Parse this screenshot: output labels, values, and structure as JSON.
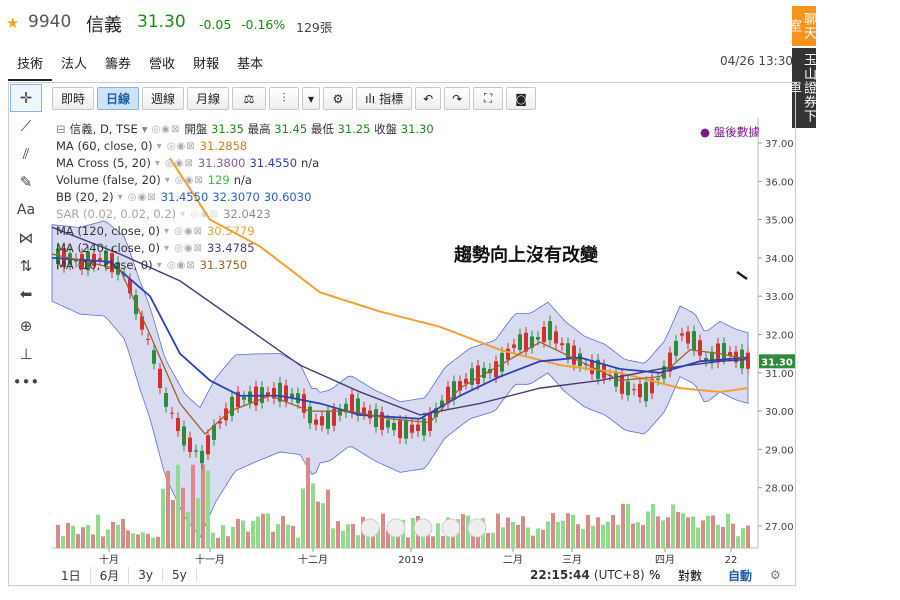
{
  "stock": {
    "code": "9940",
    "name": "信義",
    "price": "31.30",
    "change": "-0.05",
    "change_pct": "-0.16%",
    "volume": "129張"
  },
  "side_tabs": {
    "chat": "聊天室",
    "broker": "玉山證券下單"
  },
  "nav_tabs": [
    "技術",
    "法人",
    "籌券",
    "營收",
    "財報",
    "基本"
  ],
  "datetime": "04/26 13:30",
  "toolbar": {
    "intraday": "即時",
    "daily": "日線",
    "weekly": "週線",
    "monthly": "月線",
    "indicators": "指標"
  },
  "legend": {
    "main": "信義, D, TSE",
    "ohlc": {
      "open_label": "開盤",
      "open": "31.35",
      "high_label": "最高",
      "high": "31.45",
      "low_label": "最低",
      "low": "31.25",
      "close_label": "收盤",
      "close": "31.30"
    },
    "ma60": {
      "label": "MA (60, close, 0)",
      "value": "31.2858"
    },
    "macross": {
      "label": "MA Cross (5, 20)",
      "v1": "31.3800",
      "v2": "31.4550",
      "v3": "n/a"
    },
    "volume": {
      "label": "Volume (false, 20)",
      "v1": "129",
      "v2": "n/a"
    },
    "bb": {
      "label": "BB (20, 2)",
      "v1": "31.4550",
      "v2": "32.3070",
      "v3": "30.6030"
    },
    "sar": {
      "label": "SAR (0.02, 0.02, 0.2)",
      "value": "32.0423"
    },
    "ma120": {
      "label": "MA (120, close, 0)",
      "value": "30.5779"
    },
    "ma240": {
      "label": "MA (240, close, 0)",
      "value": "33.4785"
    },
    "ma10": {
      "label": "MA (10, close, 0)",
      "value": "31.3750"
    }
  },
  "after_hours": "● 盤後數據",
  "annotation": "趨勢向上沒有改變",
  "current_price_tag": "31.30",
  "bottom": {
    "r1": "1日",
    "r2": "6月",
    "r3": "3y",
    "r4": "5y",
    "clock": "22:15:44",
    "tz": "(UTC+8)",
    "pct": "%",
    "log": "對數",
    "auto": "自動"
  },
  "colors": {
    "up": "#d32f2f",
    "down": "#2e8b3a",
    "band_fill": "#c5cae9",
    "ma_orange": "#f0a030",
    "ma_blue": "#2b3fbf",
    "ma_purple": "#4b3a78",
    "ma_brown": "#a0602a"
  },
  "chart_data": {
    "type": "line",
    "yticks": [
      "37.00",
      "36.00",
      "35.00",
      "34.00",
      "33.00",
      "32.00",
      "31.00",
      "30.00",
      "29.00",
      "28.00",
      "27.00"
    ],
    "xticks": [
      "十月",
      "十一月",
      "十二月",
      "2019",
      "二月",
      "三月",
      "四月",
      "22"
    ],
    "ylim": [
      26.5,
      37.3
    ]
  }
}
